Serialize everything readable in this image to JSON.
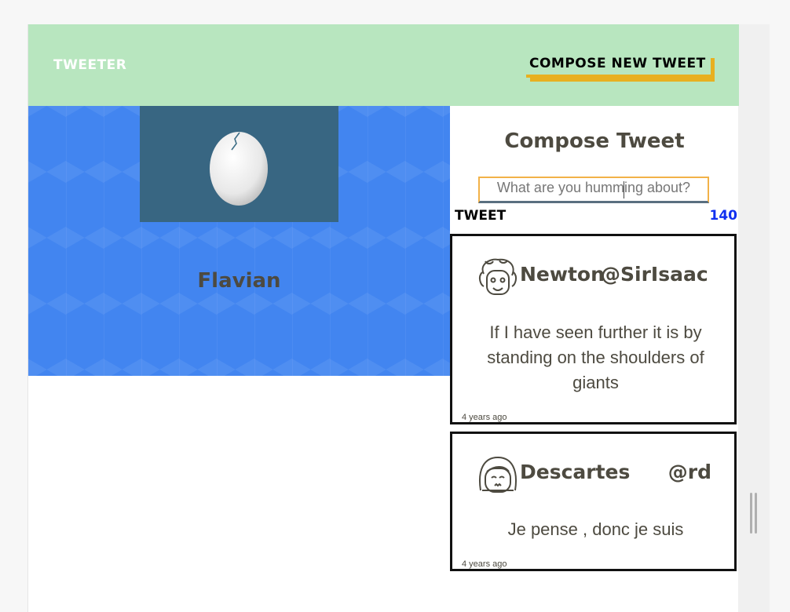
{
  "nav": {
    "brand": "tweeter",
    "compose_label": "compose new tweet"
  },
  "profile": {
    "name": "Flavian",
    "avatar_icon": "egg-avatar-icon"
  },
  "compose": {
    "title": "Compose Tweet",
    "placeholder": "What are you humming about?",
    "submit_label": "tweet",
    "counter": "140"
  },
  "tweets": [
    {
      "icon": "newton-avatar-icon",
      "name": "Newton",
      "handle": "@SirIsaac",
      "body": "If I have seen further it is by standing on the shoulders of giants",
      "time": "4 years ago"
    },
    {
      "icon": "descartes-avatar-icon",
      "name": "Descartes",
      "handle": "@rd",
      "body": "Je pense , donc je suis",
      "time": "4 years ago"
    }
  ],
  "colors": {
    "nav_bg": "#b8e6bf",
    "profile_bg": "#4285f0",
    "avatar_bg": "#386682",
    "accent": "#e8b020",
    "counter": "#1030f0",
    "text": "#4d4a40"
  }
}
